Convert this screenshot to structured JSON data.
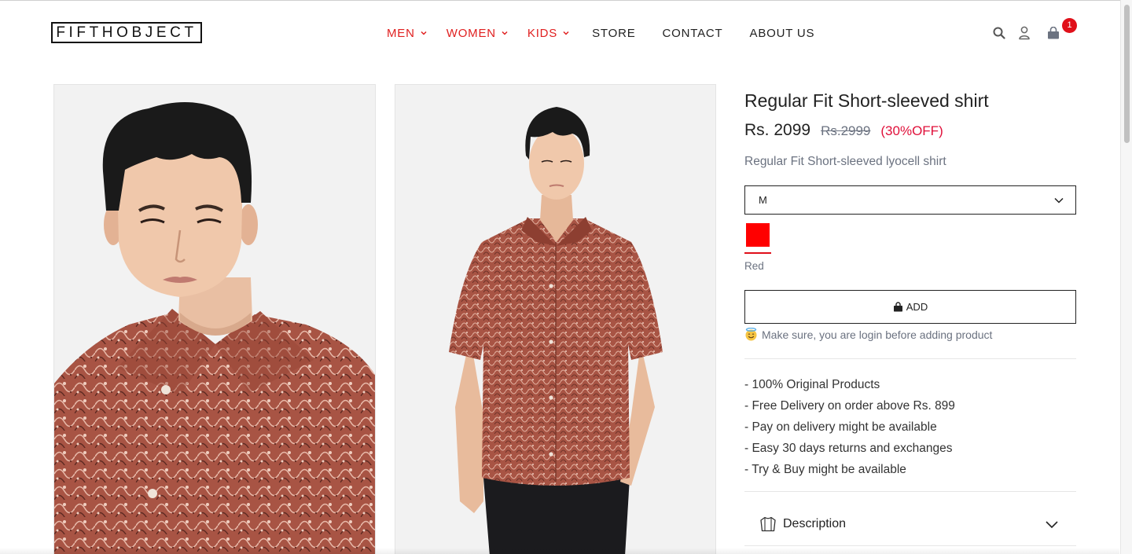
{
  "header": {
    "logo": "FIFTHOBJECT",
    "nav": [
      {
        "label": "MEN",
        "has_dropdown": true,
        "color": "#e02020"
      },
      {
        "label": "WOMEN",
        "has_dropdown": true,
        "color": "#e02020"
      },
      {
        "label": "KIDS",
        "has_dropdown": true,
        "color": "#e02020"
      },
      {
        "label": "STORE",
        "has_dropdown": false
      },
      {
        "label": "CONTACT",
        "has_dropdown": false
      },
      {
        "label": "ABOUT US",
        "has_dropdown": false
      }
    ],
    "icons": [
      "search-icon",
      "user-icon",
      "cart-icon"
    ],
    "cart_count": "1"
  },
  "product": {
    "title": "Regular Fit Short-sleeved shirt",
    "price": "Rs. 2099",
    "old_price": "Rs.2999",
    "discount": "(30%OFF)",
    "short_description": "Regular Fit Short-sleeved lyocell shirt",
    "size_selected": "M",
    "color_name": "Red",
    "color_hex": "#ff0000",
    "add_label": "ADD",
    "login_note": "Make sure, you are login before adding product",
    "features": [
      "- 100% Original Products",
      "- Free Delivery on order above Rs. 899",
      "- Pay on delivery might be available",
      "- Easy 30 days returns and exchanges",
      "- Try & Buy might be available"
    ],
    "accordion_label": "Description"
  },
  "colors": {
    "accent_red": "#e02020",
    "badge_red": "#e0101a",
    "discount_red": "#e0103a",
    "muted_text": "#6b7280",
    "shirt_pattern": "#9c4a3c"
  }
}
